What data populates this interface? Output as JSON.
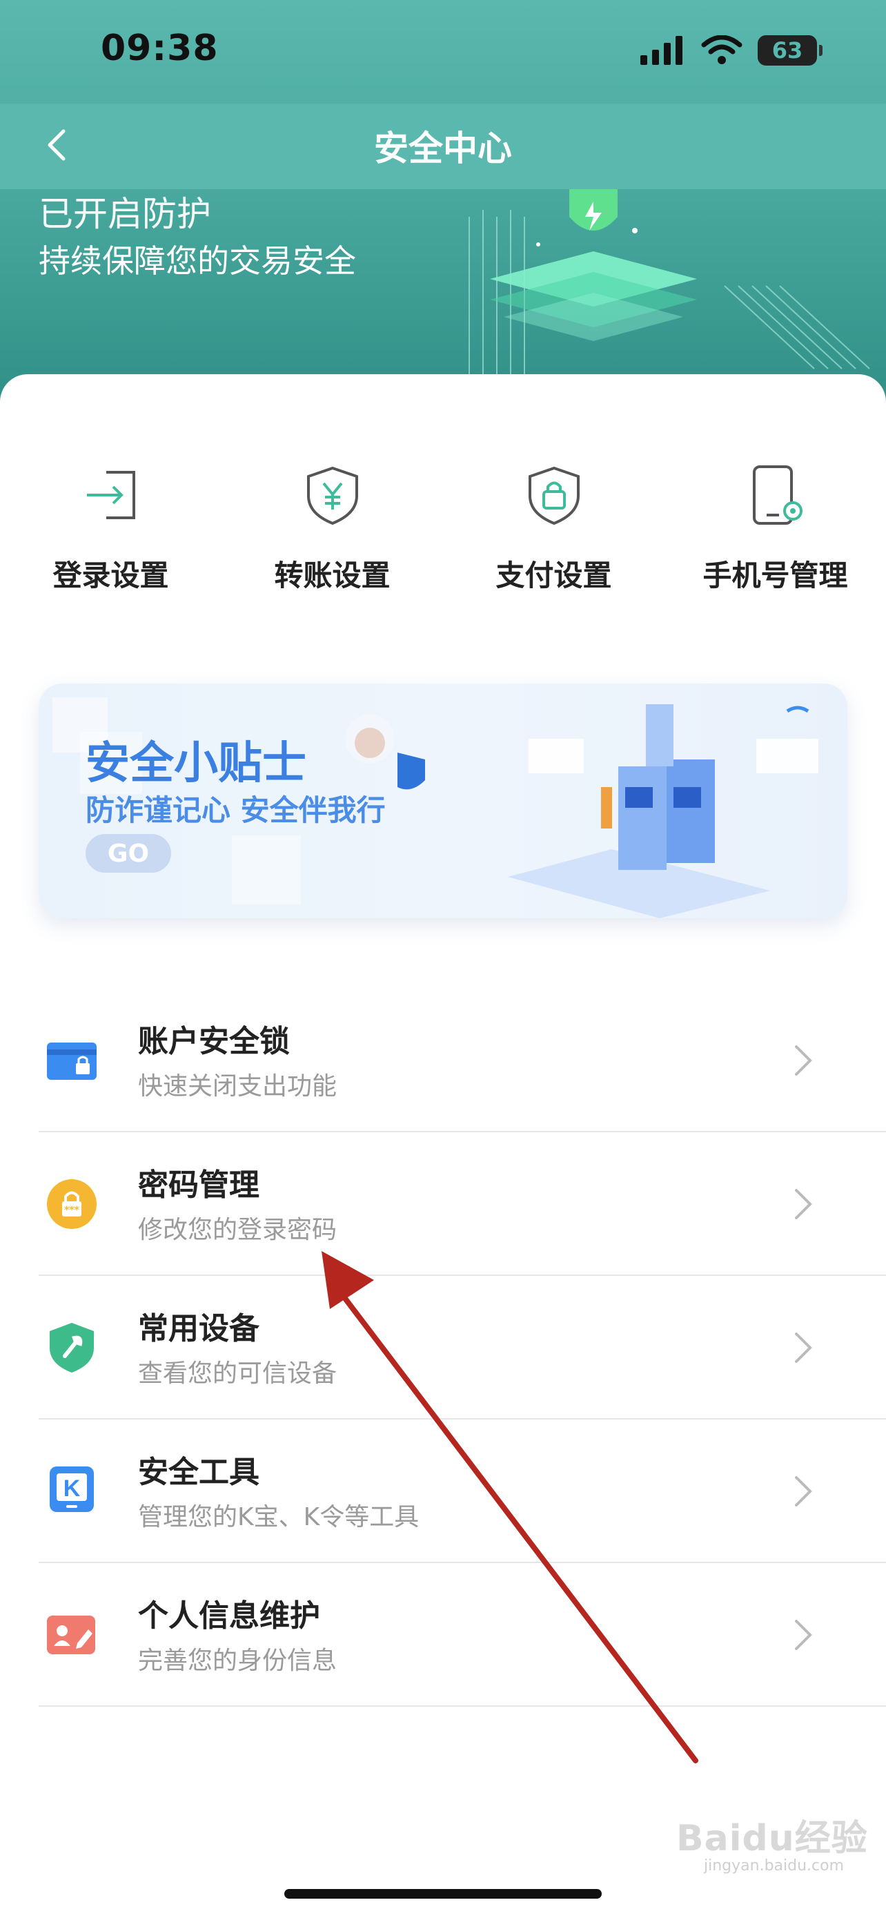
{
  "status_bar": {
    "time": "09:38",
    "battery": "63"
  },
  "navbar": {
    "title": "安全中心",
    "back_icon": "chevron-left-icon"
  },
  "hero": {
    "title": "已开启防护",
    "subtitle": "持续保障您的交易安全"
  },
  "quick_actions": [
    {
      "label": "登录设置",
      "icon": "login-arrow-icon"
    },
    {
      "label": "转账设置",
      "icon": "yuan-shield-icon"
    },
    {
      "label": "支付设置",
      "icon": "lock-shield-icon"
    },
    {
      "label": "手机号管理",
      "icon": "phone-gear-icon"
    }
  ],
  "banner": {
    "title": "安全小贴士",
    "subtitle": "防诈谨记心 安全伴我行",
    "go_label": "GO"
  },
  "menu": [
    {
      "title": "账户安全锁",
      "subtitle": "快速关闭支出功能",
      "icon": "card-lock-icon",
      "color": "#3b8cf0"
    },
    {
      "title": "密码管理",
      "subtitle": "修改您的登录密码",
      "icon": "password-lock-icon",
      "color": "#f5b731"
    },
    {
      "title": "常用设备",
      "subtitle": "查看您的可信设备",
      "icon": "device-shield-icon",
      "color": "#3dbb8a"
    },
    {
      "title": "安全工具",
      "subtitle": "管理您的K宝、K令等工具",
      "icon": "k-token-icon",
      "color": "#3b8cf0"
    },
    {
      "title": "个人信息维护",
      "subtitle": "完善您的身份信息",
      "icon": "id-card-edit-icon",
      "color": "#f07a6e"
    }
  ],
  "colors": {
    "primary": "#5ab8ae",
    "banner_blue": "#3b7fe0",
    "annotation_arrow": "#b5261e"
  },
  "watermark": {
    "text": "Baidu经验",
    "sub": "jingyan.baidu.com"
  }
}
